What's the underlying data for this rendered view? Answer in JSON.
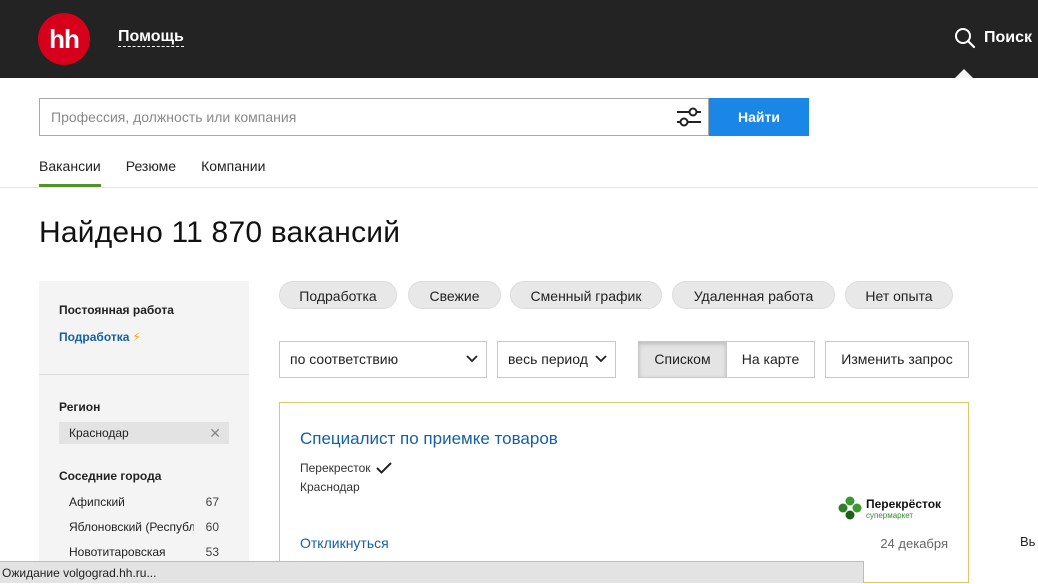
{
  "header": {
    "logo_text": "hh",
    "help_link": "Помощь",
    "search_link": "Поиск"
  },
  "search": {
    "placeholder": "Профессия, должность или компания",
    "submit_label": "Найти"
  },
  "tabs": [
    {
      "label": "Вакансии",
      "active": true
    },
    {
      "label": "Резюме",
      "active": false
    },
    {
      "label": "Компании",
      "active": false
    }
  ],
  "page_title": "Найдено 11 870 вакансий",
  "sidebar": {
    "employment_title": "Постоянная работа",
    "employment_link": "Подработка",
    "region_title": "Регион",
    "region_value": "Краснодар",
    "nearby_title": "Соседние города",
    "nearby_cities": [
      {
        "name": "Афипский",
        "count": "67"
      },
      {
        "name": "Яблоновский (Республ",
        "count": "60"
      },
      {
        "name": "Новотитаровская",
        "count": "53"
      }
    ]
  },
  "quick_filters": [
    "Подработка",
    "Свежие",
    "Сменный график",
    "Удаленная работа",
    "Нет опыта"
  ],
  "controls": {
    "sort_value": "по соответствию",
    "period_value": "весь период",
    "view_list": "Списком",
    "view_map": "На карте",
    "edit_query": "Изменить запрос"
  },
  "vacancy": {
    "title": "Специалист по приемке товаров",
    "company": "Перекресток",
    "city": "Краснодар",
    "respond": "Откликнуться",
    "date": "24 декабря",
    "logo_name": "Перекрёсток",
    "logo_sub": "супермаркет"
  },
  "edge_text": "Вь",
  "status_bar": "Ожидание volgograd.hh.ru...",
  "colors": {
    "header_bg": "#232323",
    "brand_red": "#d6001c",
    "primary_blue": "#1a87e6",
    "link_blue": "#1560a3",
    "tab_active": "#56912a",
    "card_border": "#e0c56a"
  }
}
